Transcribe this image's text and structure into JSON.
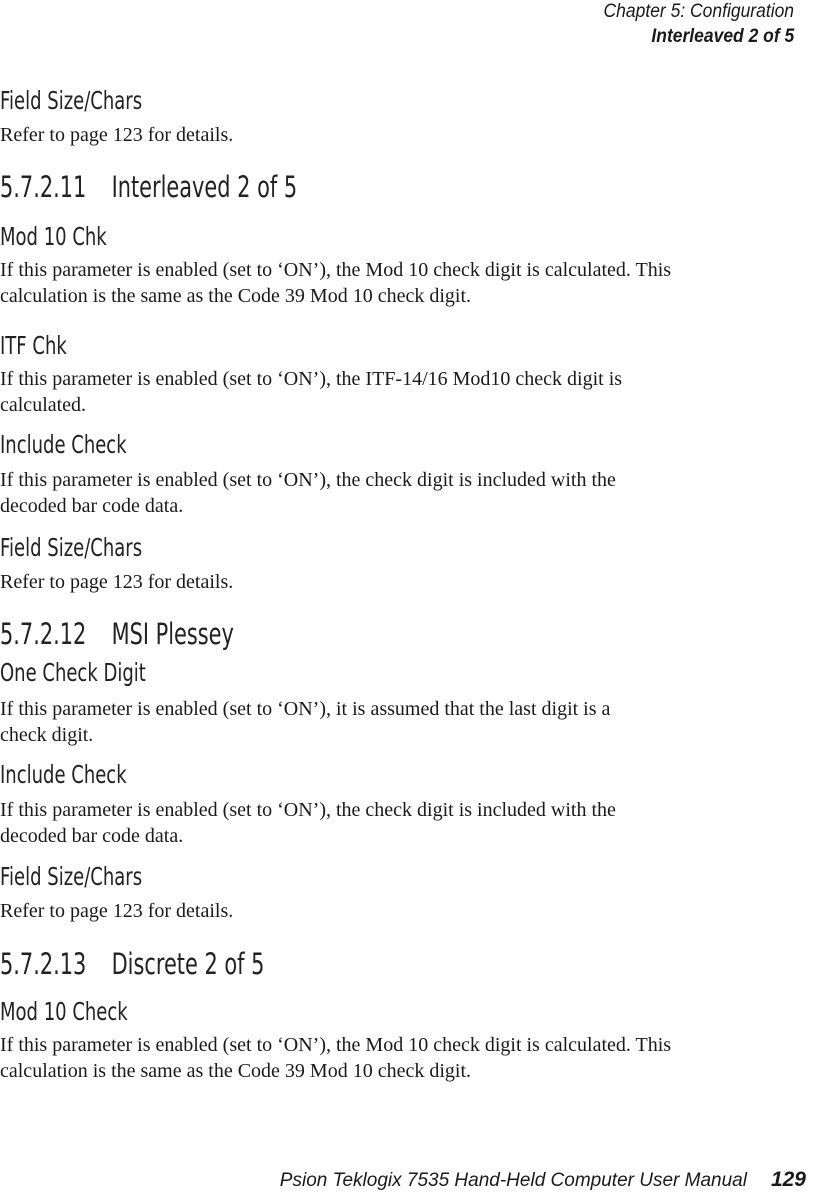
{
  "header": {
    "chapter": "Chapter  5:  Configuration",
    "section": "Interleaved 2 of 5"
  },
  "content": [
    {
      "type": "sub",
      "text": "Field Size/Chars"
    },
    {
      "type": "para",
      "lines": [
        "Refer to page 123 for details."
      ]
    },
    {
      "type": "sec",
      "number": "5.7.2.11",
      "title": "Interleaved 2 of 5"
    },
    {
      "type": "sub",
      "text": "Mod 10 Chk"
    },
    {
      "type": "para",
      "lines": [
        "If this parameter is enabled (set to ‘ON’), the Mod 10 check digit is calculated. This",
        "calculation is the same as the Code 39 Mod 10 check digit."
      ]
    },
    {
      "type": "sub",
      "text": "ITF Chk"
    },
    {
      "type": "para",
      "lines": [
        "If this parameter is enabled (set to ‘ON’), the ITF-14/16 Mod10 check digit is",
        "calculated."
      ]
    },
    {
      "type": "sub",
      "text": "Include Check"
    },
    {
      "type": "para",
      "lines": [
        "If this parameter is enabled (set to ‘ON’), the check digit is included with the",
        "decoded bar code data."
      ]
    },
    {
      "type": "sub",
      "text": "Field Size/Chars"
    },
    {
      "type": "para",
      "lines": [
        "Refer to page 123 for details."
      ]
    },
    {
      "type": "sec",
      "number": "5.7.2.12",
      "title": "MSI Plessey"
    },
    {
      "type": "sub",
      "text": "One Check Digit"
    },
    {
      "type": "para",
      "lines": [
        "If this parameter is enabled (set to ‘ON’), it is assumed that the last digit is a",
        "check digit."
      ]
    },
    {
      "type": "sub",
      "text": "Include Check"
    },
    {
      "type": "para",
      "lines": [
        "If this parameter is enabled (set to ‘ON’), the check digit is included with the",
        "decoded bar code data."
      ]
    },
    {
      "type": "sub",
      "text": "Field Size/Chars"
    },
    {
      "type": "para",
      "lines": [
        "Refer to page 123 for details."
      ]
    },
    {
      "type": "sec",
      "number": "5.7.2.13",
      "title": "Discrete 2 of 5"
    },
    {
      "type": "sub",
      "text": "Mod 10 Check"
    },
    {
      "type": "para",
      "lines": [
        "If this parameter is enabled (set to ‘ON’), the Mod 10 check digit is calculated. This",
        "calculation is the same as the Code 39 Mod 10 check digit."
      ]
    }
  ],
  "footer": {
    "manual_title": "Psion Teklogix 7535 Hand-Held Computer User Manual",
    "page_number": "129"
  }
}
